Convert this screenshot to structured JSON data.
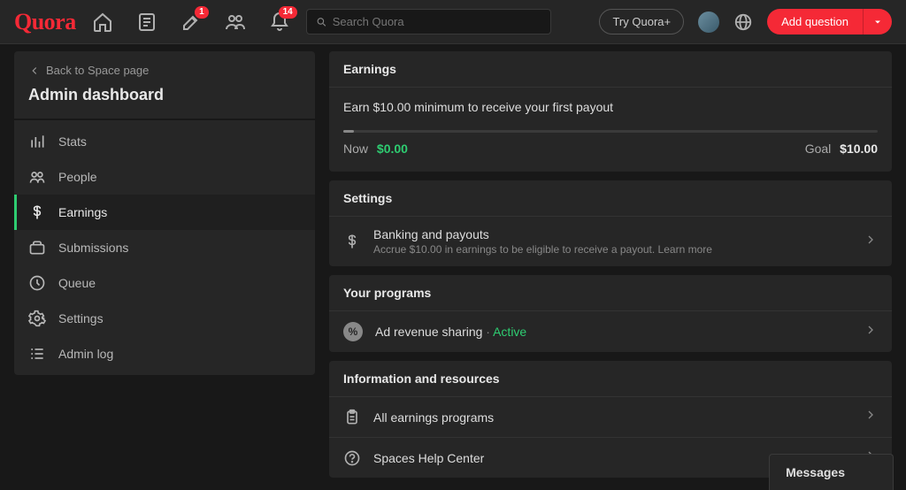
{
  "header": {
    "logo": "Quora",
    "search_placeholder": "Search Quora",
    "try_plus": "Try Quora+",
    "add_question": "Add question",
    "badges": {
      "edit": "1",
      "bell": "14"
    }
  },
  "sidebar": {
    "back": "Back to Space page",
    "title": "Admin dashboard",
    "items": [
      {
        "label": "Stats"
      },
      {
        "label": "People"
      },
      {
        "label": "Earnings"
      },
      {
        "label": "Submissions"
      },
      {
        "label": "Queue"
      },
      {
        "label": "Settings"
      },
      {
        "label": "Admin log"
      }
    ]
  },
  "earnings": {
    "header": "Earnings",
    "message": "Earn $10.00 minimum to receive your first payout",
    "now_label": "Now",
    "now_value": "$0.00",
    "goal_label": "Goal",
    "goal_value": "$10.00"
  },
  "settings": {
    "header": "Settings",
    "banking_title": "Banking and payouts",
    "banking_sub": "Accrue $10.00 in earnings to be eligible to receive a payout. ",
    "learn_more": "Learn more"
  },
  "programs": {
    "header": "Your programs",
    "ad_rev": "Ad revenue sharing",
    "sep": " · ",
    "status": "Active"
  },
  "info": {
    "header": "Information and resources",
    "all_programs": "All earnings programs",
    "help_center": "Spaces Help Center"
  },
  "messages_label": "Messages"
}
